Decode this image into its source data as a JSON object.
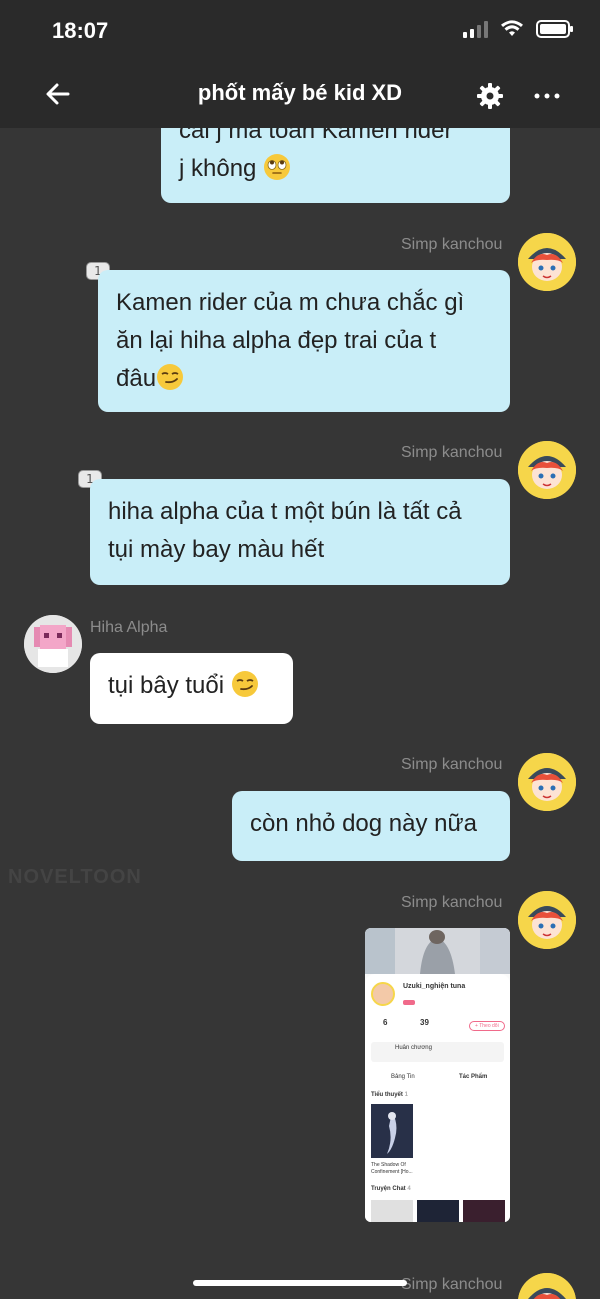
{
  "status": {
    "time": "18:07"
  },
  "header": {
    "title": "phốt mấy bé kid XD"
  },
  "messages": [
    {
      "id": "m0",
      "side": "mine",
      "text": "cái j mà toàn Kamen rider\nj không 🙄"
    },
    {
      "id": "m1",
      "side": "mine",
      "sender": "Simp kanchou",
      "badge": "1",
      "text": "Kamen rider của m chưa chắc gì ăn lại hiha alpha đẹp trai của t đâu😏"
    },
    {
      "id": "m2",
      "side": "mine",
      "sender": "Simp kanchou",
      "badge": "1",
      "text": "hiha alpha của t một bún là tất cả tụi mày bay màu hết"
    },
    {
      "id": "m3",
      "side": "other",
      "sender": "Hiha Alpha",
      "text": "tụi bây tuổi 😏"
    },
    {
      "id": "m4",
      "side": "mine",
      "sender": "Simp kanchou",
      "text": "còn nhỏ dog này nữa"
    },
    {
      "id": "m5",
      "side": "mine",
      "sender": "Simp kanchou",
      "type": "image"
    },
    {
      "id": "m6",
      "side": "mine",
      "sender": "Simp kanchou"
    }
  ],
  "watermark": "NOVELTOON",
  "screenshot": {
    "username": "Uzuki_nghiện tuna",
    "stat1": "6",
    "stat2": "39",
    "follow": "+ Theo dõi",
    "medal": "Huân chương",
    "tab1": "Bảng Tin",
    "tab2": "Tác Phẩm",
    "section1": "Tiểu thuyết",
    "section1_count": "1",
    "book": "The Shadow Of Confinement [Ho...",
    "section2": "Truyện Chat",
    "section2_count": "4"
  },
  "colors": {
    "mine_bubble": "#c9eef8",
    "other_bubble": "#ffffff",
    "background": "#363636"
  }
}
